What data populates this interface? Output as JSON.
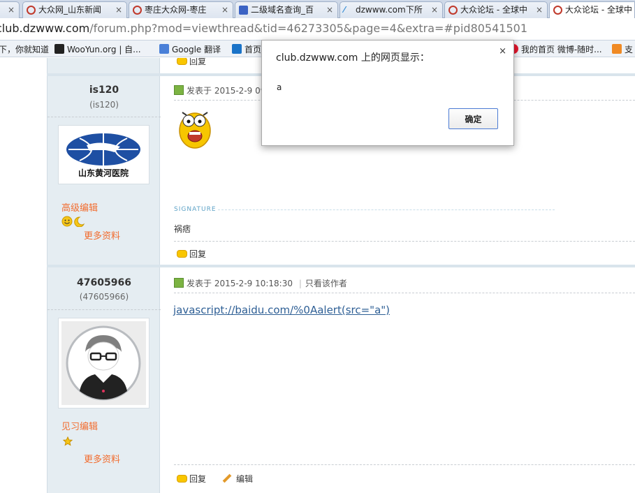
{
  "tabs": [
    {
      "label": "大众网_山东新闻",
      "favicon": "dazhong-icon"
    },
    {
      "label": "枣庄大众网-枣庄",
      "favicon": "dazhong-icon"
    },
    {
      "label": "二级域名查询_百",
      "favicon": "baidu-paw-icon"
    },
    {
      "label": "dzwww.com下所",
      "favicon": "dz-icon"
    },
    {
      "label": "大众论坛 - 全球中",
      "favicon": "dazhong-icon"
    },
    {
      "label": "大众论坛 - 全球中",
      "favicon": "dazhong-icon"
    }
  ],
  "tab_close_glyph": "×",
  "address": {
    "host": "club.dzwww.com",
    "path": "/forum.php?mod=viewthread&tid=46273305&page=4&extra=#pid80541501"
  },
  "bookmarks": [
    {
      "label": "下，你就知道",
      "icon": "baidu-icon"
    },
    {
      "label": "WooYun.org | 自...",
      "icon": "wooyun-icon"
    },
    {
      "label": "Google 翻译",
      "icon": "translate-icon"
    },
    {
      "label": "首页",
      "icon": "zhihu-icon"
    },
    {
      "label": "我的首页 微博-随时...",
      "icon": "weibo-icon"
    },
    {
      "label": "支",
      "icon": "extension-icon"
    }
  ],
  "colors": {
    "accent_orange": "#f26c2e",
    "link_blue": "#2e5f95",
    "ok_border": "#4b7bd4"
  },
  "posts": [
    {
      "username": "is120",
      "userid": "(is120)",
      "group": "高级编辑",
      "more": "更多资料",
      "posted": "发表于 2015-2-9 09",
      "signature_label": "SIGNATURE",
      "signature": "祸痞",
      "reply": "回复"
    },
    {
      "username": "47605966",
      "userid": "(47605966)",
      "group": "见习编辑",
      "more": "更多资料",
      "posted": "发表于 2015-2-9 10:18:30",
      "only_author": "只看该作者",
      "content_link": "javascript://baidu.com/%0Aalert(src=\"a\")",
      "reply": "回复",
      "edit": "编辑"
    }
  ],
  "prev_reply": "回复",
  "dialog": {
    "title": "club.dzwww.com 上的网页显示：",
    "close": "×",
    "message": "a",
    "ok": "确定"
  }
}
